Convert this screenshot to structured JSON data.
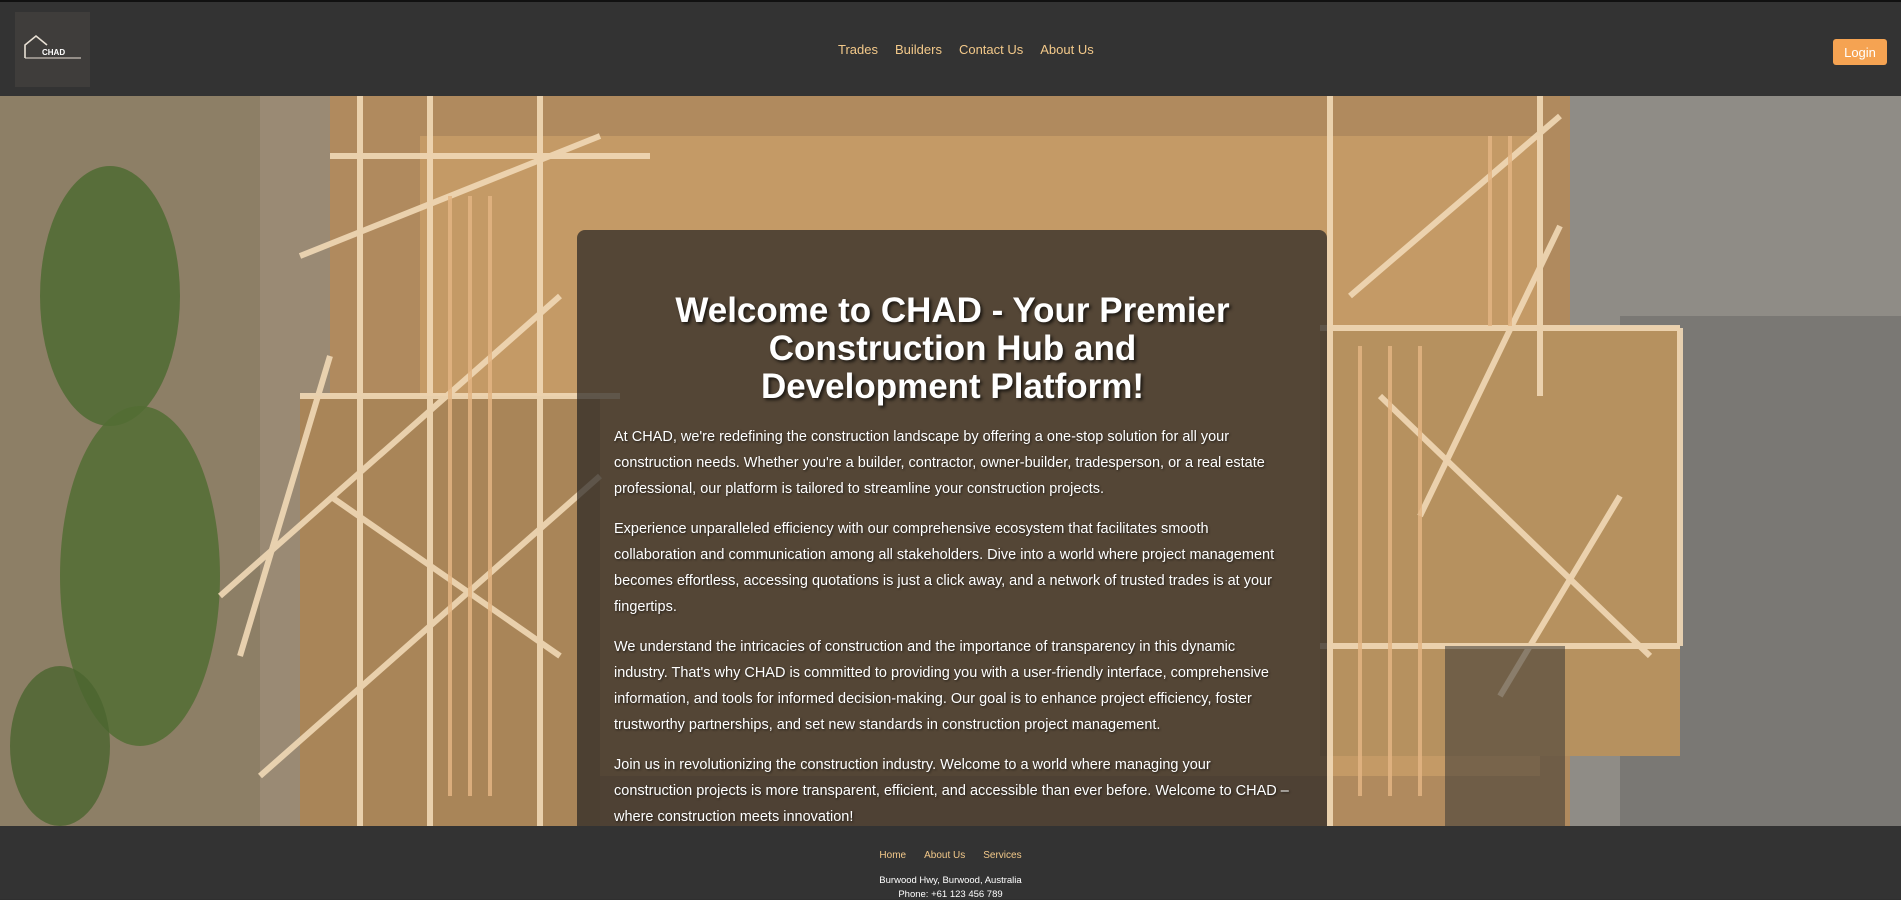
{
  "header": {
    "logo_text": "CHAD",
    "nav": [
      {
        "label": "Trades"
      },
      {
        "label": "Builders"
      },
      {
        "label": "Contact Us"
      },
      {
        "label": "About Us"
      }
    ],
    "login_label": "Login"
  },
  "hero": {
    "title": "Welcome to CHAD - Your Premier Construction Hub and Development Platform!",
    "paragraphs": [
      "At CHAD, we're redefining the construction landscape by offering a one-stop solution for all your construction needs. Whether you're a builder, contractor, owner-builder, tradesperson, or a real estate professional, our platform is tailored to streamline your construction projects.",
      "Experience unparalleled efficiency with our comprehensive ecosystem that facilitates smooth collaboration and communication among all stakeholders. Dive into a world where project management becomes effortless, accessing quotations is just a click away, and a network of trusted trades is at your fingertips.",
      "We understand the intricacies of construction and the importance of transparency in this dynamic industry. That's why CHAD is committed to providing you with a user-friendly interface, comprehensive information, and tools for informed decision-making. Our goal is to enhance project efficiency, foster trustworthy partnerships, and set new standards in construction project management.",
      "Join us in revolutionizing the construction industry. Welcome to a world where managing your construction projects is more transparent, efficient, and accessible than ever before. Welcome to CHAD – where construction meets innovation!"
    ]
  },
  "footer": {
    "links": [
      {
        "label": "Home"
      },
      {
        "label": "About Us"
      },
      {
        "label": "Services"
      }
    ],
    "address": "Burwood Hwy, Burwood, Australia",
    "phone": "Phone: +61 123 456 789"
  },
  "colors": {
    "accent": "#f5a352",
    "nav_link": "#f3c98a",
    "header_bg": "#333333"
  }
}
